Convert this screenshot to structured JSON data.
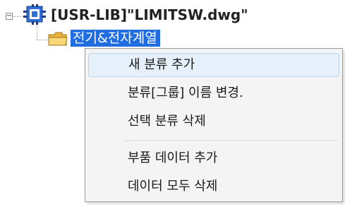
{
  "tree": {
    "root": {
      "expander_symbol": "−",
      "icon": "app-component-icon",
      "label": "[USR-LIB]\"LIMITSW.dwg\""
    },
    "child": {
      "icon": "folder-icon",
      "label": "전기&전자계열",
      "selected": true
    }
  },
  "context_menu": {
    "items": [
      {
        "label": "새 분류 추가",
        "highlighted": true
      },
      {
        "label": "분류[그룹] 이름 변경."
      },
      {
        "label": "선택 분류 삭제"
      },
      {
        "label": "부품 데이터 추가"
      },
      {
        "label": "데이터 모두 삭제"
      }
    ]
  },
  "colors": {
    "selection": "#1f6de0",
    "menu_background": "#f4f4f4",
    "menu_hover": "#e6f0fa",
    "icon_blue": "#2f6fd6",
    "folder_yellow": "#f1c44a"
  }
}
